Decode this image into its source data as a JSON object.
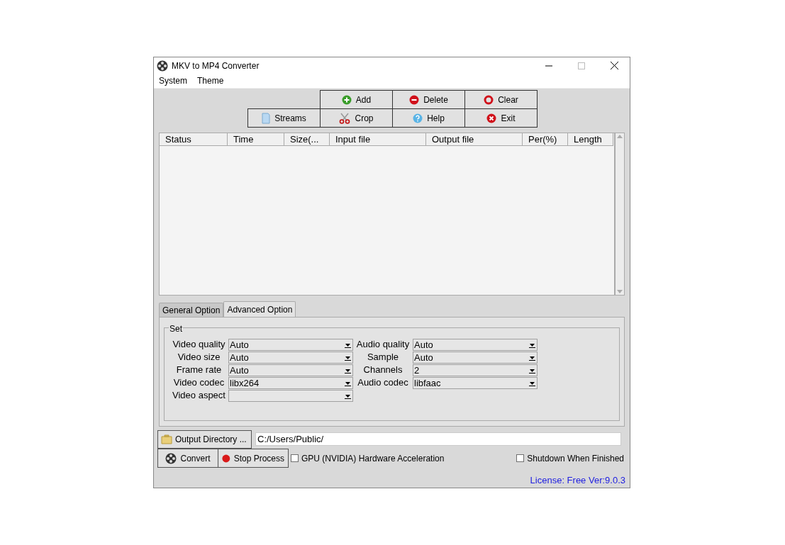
{
  "window": {
    "title": "MKV to MP4 Converter"
  },
  "menu": [
    "System",
    "Theme"
  ],
  "toolbar": {
    "rows": [
      {
        "items": [
          {
            "kind": "add",
            "label": "Add"
          },
          {
            "kind": "delete",
            "label": "Delete"
          },
          {
            "kind": "clear",
            "label": "Clear"
          }
        ]
      },
      {
        "items": [
          {
            "kind": "streams",
            "label": "Streams"
          },
          {
            "kind": "crop",
            "label": "Crop"
          },
          {
            "kind": "help",
            "label": "Help"
          },
          {
            "kind": "exit",
            "label": "Exit"
          }
        ]
      }
    ]
  },
  "table": {
    "columns": [
      "Status",
      "Time",
      "Size(...",
      "Input file",
      "Output file",
      "Per(%)",
      "Length"
    ]
  },
  "tabs": [
    {
      "label": "General Option",
      "selected": false
    },
    {
      "label": "Advanced Option",
      "selected": true
    }
  ],
  "group": {
    "title": "Set",
    "left": [
      {
        "label": "Video quality",
        "value": "Auto"
      },
      {
        "label": "Video size",
        "value": "Auto"
      },
      {
        "label": "Frame rate",
        "value": "Auto"
      },
      {
        "label": "Video codec",
        "value": "libx264"
      },
      {
        "label": "Video aspect"
      }
    ],
    "right": [
      {
        "label": "Audio quality",
        "value": "Auto"
      },
      {
        "label": "Sample",
        "value": "Auto"
      },
      {
        "label": "Channels",
        "value": "2"
      },
      {
        "label": "Audio codec",
        "value": "libfaac"
      }
    ]
  },
  "output": {
    "button": "Output Directory ...",
    "path": "C:/Users/Public/"
  },
  "actions": [
    {
      "kind": "convert",
      "label": "Convert"
    },
    {
      "kind": "stop",
      "label": "Stop Process"
    }
  ],
  "options": [
    {
      "label": "GPU (NVIDIA) Hardware Acceleration",
      "checked": false
    },
    {
      "label": "Shutdown When Finished",
      "checked": false
    }
  ],
  "license": "License: Free Ver:9.0.3"
}
